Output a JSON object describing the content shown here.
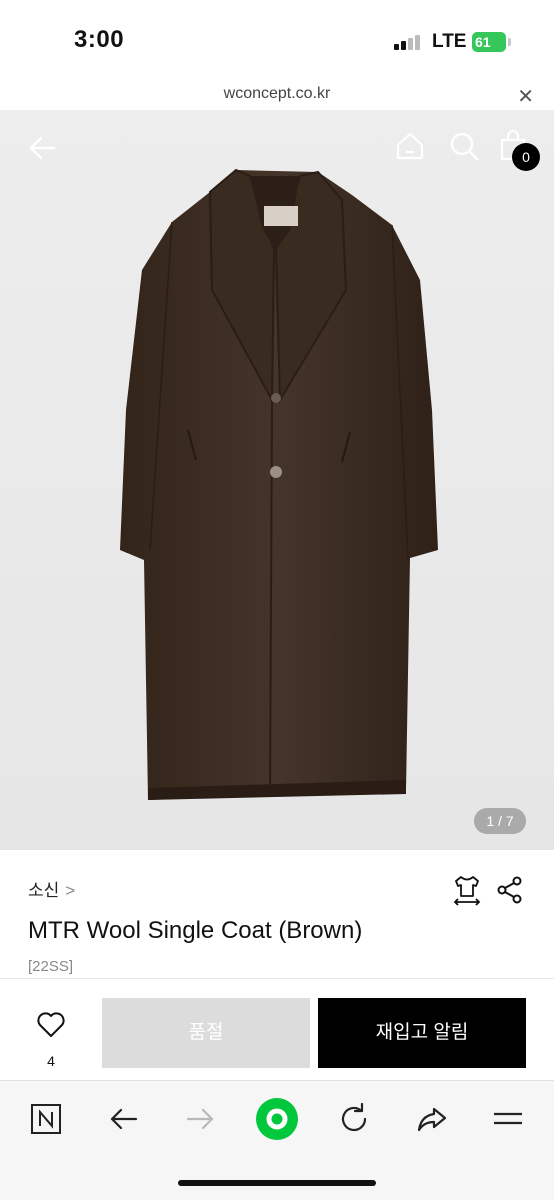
{
  "status_bar": {
    "time": "3:00",
    "network": "LTE",
    "battery": "61"
  },
  "browser": {
    "url": "wconcept.co.kr",
    "close_icon": "close-icon"
  },
  "hero": {
    "image_description_icon": "coat-photo",
    "cart_count": "0",
    "page_indicator": "1 / 7"
  },
  "product": {
    "brand": "소신",
    "brand_chevron": ">",
    "title": "MTR Wool Single Coat (Brown)",
    "season": "[22SS]"
  },
  "actions": {
    "like_count": "4",
    "soldout_label": "품절",
    "restock_label": "재입고 알림"
  },
  "toolbar": {
    "items": [
      "naver-n-icon",
      "back-arrow-icon",
      "forward-arrow-icon",
      "home-green-icon",
      "refresh-icon",
      "share-arrow-icon",
      "menu-icon"
    ]
  },
  "colors": {
    "accent_green": "#00c73c",
    "soldout_gray": "#dcdcdc",
    "primary_black": "#000000",
    "coat_brown": "#3e2e25"
  }
}
